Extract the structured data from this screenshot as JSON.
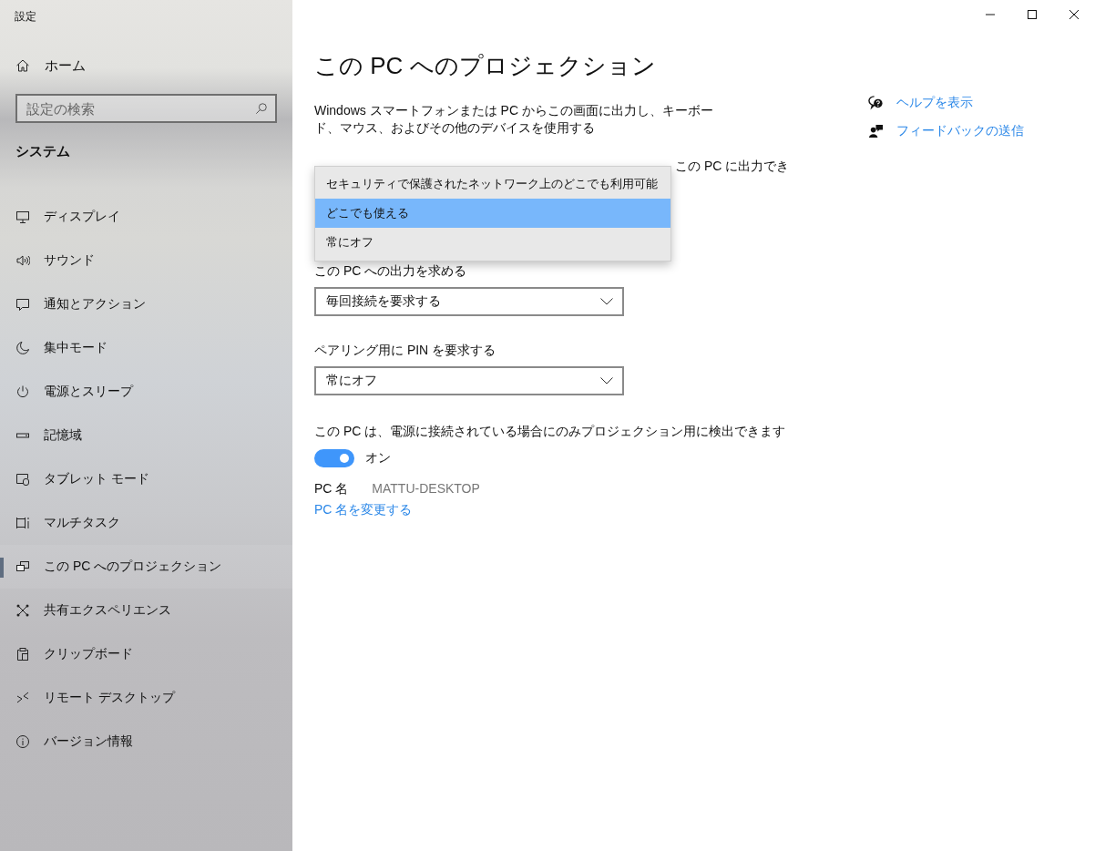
{
  "window": {
    "title": "設定"
  },
  "sidebar": {
    "home": "ホーム",
    "search": {
      "placeholder": "設定の検索"
    },
    "section": "システム",
    "items": [
      {
        "label": "ディスプレイ",
        "selected": false
      },
      {
        "label": "サウンド",
        "selected": false
      },
      {
        "label": "通知とアクション",
        "selected": false
      },
      {
        "label": "集中モード",
        "selected": false
      },
      {
        "label": "電源とスリープ",
        "selected": false
      },
      {
        "label": "記憶域",
        "selected": false
      },
      {
        "label": "タブレット モード",
        "selected": false
      },
      {
        "label": "マルチタスク",
        "selected": false
      },
      {
        "label": "この PC へのプロジェクション",
        "selected": true
      },
      {
        "label": "共有エクスペリエンス",
        "selected": false
      },
      {
        "label": "クリップボード",
        "selected": false
      },
      {
        "label": "リモート デスクトップ",
        "selected": false
      },
      {
        "label": "バージョン情報",
        "selected": false
      }
    ]
  },
  "page": {
    "title": "この PC へのプロジェクション",
    "description": "Windows スマートフォンまたは PC からこの画面に出力し、キーボード、マウス、およびその他のデバイスを使用する",
    "partial_label": "この PC に出力でき",
    "dropdown_popup": {
      "options": [
        {
          "label": "セキュリティで保護されたネットワーク上のどこでも利用可能",
          "selected": false
        },
        {
          "label": "どこでも使える",
          "selected": true
        },
        {
          "label": "常にオフ",
          "selected": false
        }
      ]
    },
    "settings": [
      {
        "label": "この PC への出力を求める",
        "value": "毎回接続を要求する"
      },
      {
        "label": "ペアリング用に PIN を要求する",
        "value": "常にオフ"
      }
    ],
    "power": {
      "label": "この PC は、電源に接続されている場合にのみプロジェクション用に検出できます",
      "toggle": {
        "on": true,
        "label": "オン"
      }
    },
    "pc_name": {
      "label": "PC 名",
      "value": "MATTU-DESKTOP"
    },
    "rename_link": "PC 名を変更する"
  },
  "help": {
    "links": [
      "ヘルプを表示",
      "フィードバックの送信"
    ]
  }
}
